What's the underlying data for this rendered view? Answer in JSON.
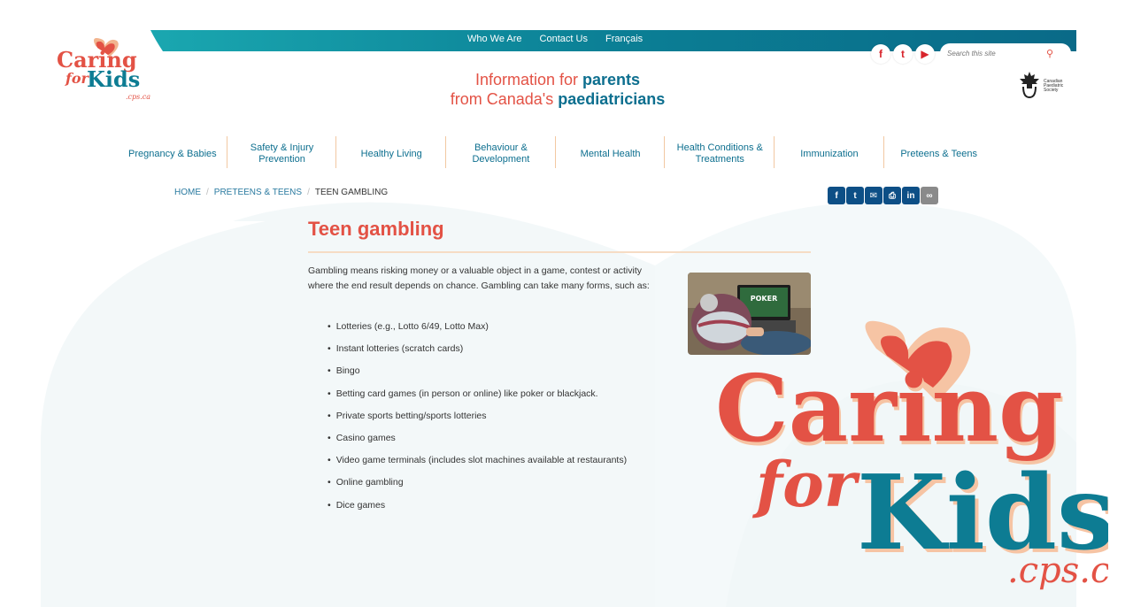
{
  "top_links": [
    "Who We Are",
    "Contact Us",
    "Français"
  ],
  "logo": {
    "word1": "Caring",
    "word2": "for",
    "word3": "Kids",
    "domain": ".cps.ca"
  },
  "tagline": {
    "line1_plain": "Information for ",
    "line1_bold": "parents",
    "line2_plain": "from Canada's ",
    "line2_bold": "paediatricians"
  },
  "social": [
    {
      "icon": "facebook-icon",
      "glyph": "f"
    },
    {
      "icon": "twitter-icon",
      "glyph": "t"
    },
    {
      "icon": "youtube-icon",
      "glyph": "▶"
    }
  ],
  "search": {
    "placeholder": "Search this site",
    "icon": "search-icon"
  },
  "cps_logo": {
    "line1": "Canadian",
    "line2": "Paediatric",
    "line3": "Society"
  },
  "nav": [
    {
      "label": "Pregnancy & Babies"
    },
    {
      "label": "Safety & Injury Prevention"
    },
    {
      "label": "Healthy Living"
    },
    {
      "label": "Behaviour & Development"
    },
    {
      "label": "Mental Health"
    },
    {
      "label": "Health Conditions & Treatments"
    },
    {
      "label": "Immunization"
    },
    {
      "label": "Preteens & Teens"
    }
  ],
  "breadcrumb": {
    "home": "HOME",
    "section": "PRETEENS & TEENS",
    "current": "TEEN GAMBLING"
  },
  "share_icons": [
    "facebook-icon",
    "twitter-icon",
    "email-icon",
    "print-icon",
    "linkedin-icon",
    "link-icon"
  ],
  "article": {
    "title": "Teen gambling",
    "intro": "Gambling means risking money or a valuable object in a game, contest or activity where the end result depends on chance. Gambling can take many forms, such as:",
    "items": [
      "Lotteries (e.g., Lotto 6/49, Lotto Max)",
      "Instant lotteries (scratch cards)",
      "Bingo",
      "Betting card games (in person or online) like poker or blackjack.",
      "Private sports betting/sports lotteries",
      "Casino games",
      "Video game terminals (includes slot machines available at restaurants)",
      "Online gambling",
      "Dice games"
    ],
    "photo_text": "POKER"
  },
  "colors": {
    "teal": "#0d7c93",
    "red": "#e35245",
    "navy": "#0d4f86",
    "peach": "#f6c4a4"
  }
}
